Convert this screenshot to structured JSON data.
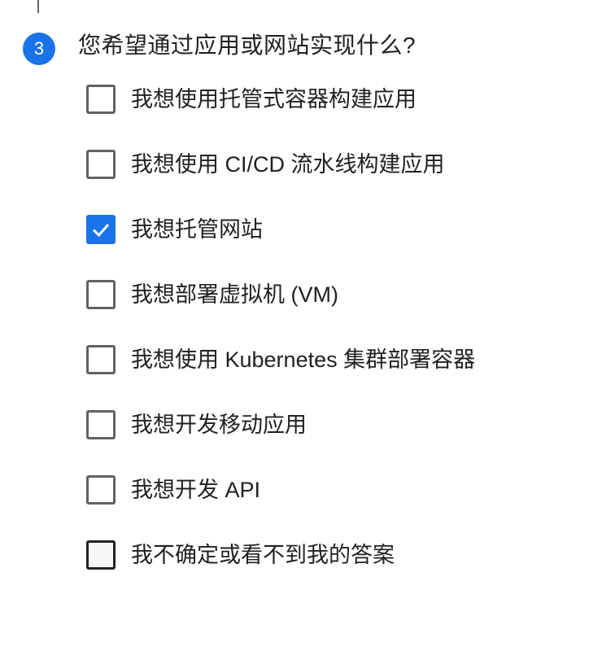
{
  "step": {
    "number": "3",
    "question": "您希望通过应用或网站实现什么?"
  },
  "colors": {
    "accent": "#1a73e8",
    "text": "#202124",
    "border": "#5f6368"
  },
  "options": [
    {
      "label": "我想使用托管式容器构建应用",
      "checked": false
    },
    {
      "label": "我想使用 CI/CD 流水线构建应用",
      "checked": false
    },
    {
      "label": "我想托管网站",
      "checked": true
    },
    {
      "label": "我想部署虚拟机 (VM)",
      "checked": false
    },
    {
      "label": "我想使用 Kubernetes 集群部署容器",
      "checked": false
    },
    {
      "label": "我想开发移动应用",
      "checked": false
    },
    {
      "label": "我想开发 API",
      "checked": false
    },
    {
      "label": "我不确定或看不到我的答案",
      "checked": false,
      "hovered": true
    }
  ]
}
